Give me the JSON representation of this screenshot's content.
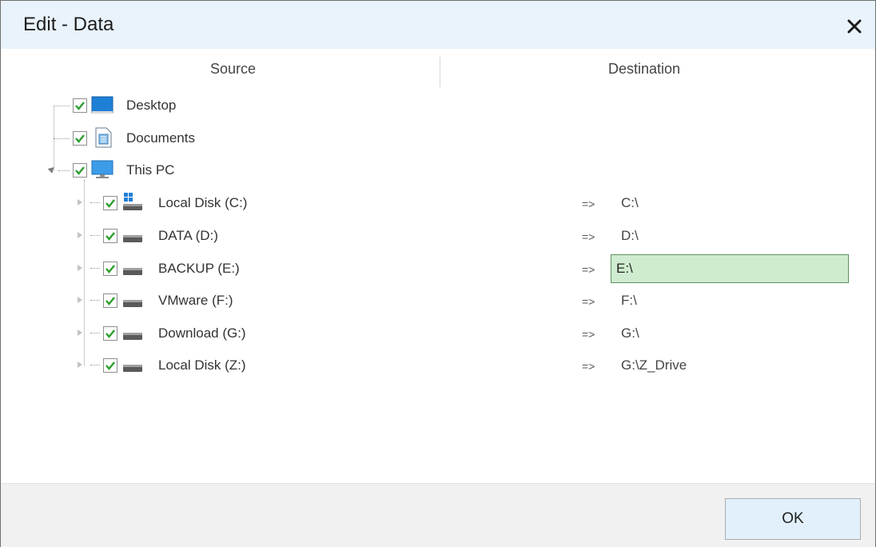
{
  "dialog": {
    "title": "Edit - Data",
    "close_icon": "close-icon"
  },
  "columns": {
    "source": "Source",
    "destination": "Destination"
  },
  "tree": {
    "top_items": [
      {
        "label": "Desktop",
        "checked": true,
        "icon": "desktop-icon"
      },
      {
        "label": "Documents",
        "checked": true,
        "icon": "documents-icon"
      },
      {
        "label": "This PC",
        "checked": true,
        "icon": "this-pc-icon",
        "expanded": true
      }
    ],
    "drives": [
      {
        "label": "Local Disk (C:)",
        "checked": true,
        "icon": "system-drive-icon",
        "arrow": "=>",
        "destination": "C:\\"
      },
      {
        "label": "DATA (D:)",
        "checked": true,
        "icon": "drive-icon",
        "arrow": "=>",
        "destination": "D:\\"
      },
      {
        "label": "BACKUP (E:)",
        "checked": true,
        "icon": "drive-icon",
        "arrow": "=>",
        "destination": "E:\\",
        "editing": true
      },
      {
        "label": "VMware (F:)",
        "checked": true,
        "icon": "drive-icon",
        "arrow": "=>",
        "destination": "F:\\"
      },
      {
        "label": "Download (G:)",
        "checked": true,
        "icon": "drive-icon",
        "arrow": "=>",
        "destination": "G:\\"
      },
      {
        "label": "Local Disk (Z:)",
        "checked": true,
        "icon": "drive-icon",
        "arrow": "=>",
        "destination": "G:\\Z_Drive"
      }
    ]
  },
  "footer": {
    "ok_label": "OK"
  },
  "colors": {
    "titlebar_bg": "#e9f3fb",
    "edit_field_bg": "#d0ecd0",
    "checkmark": "#2e9e2e",
    "footer_bg": "#f1f1f1"
  }
}
